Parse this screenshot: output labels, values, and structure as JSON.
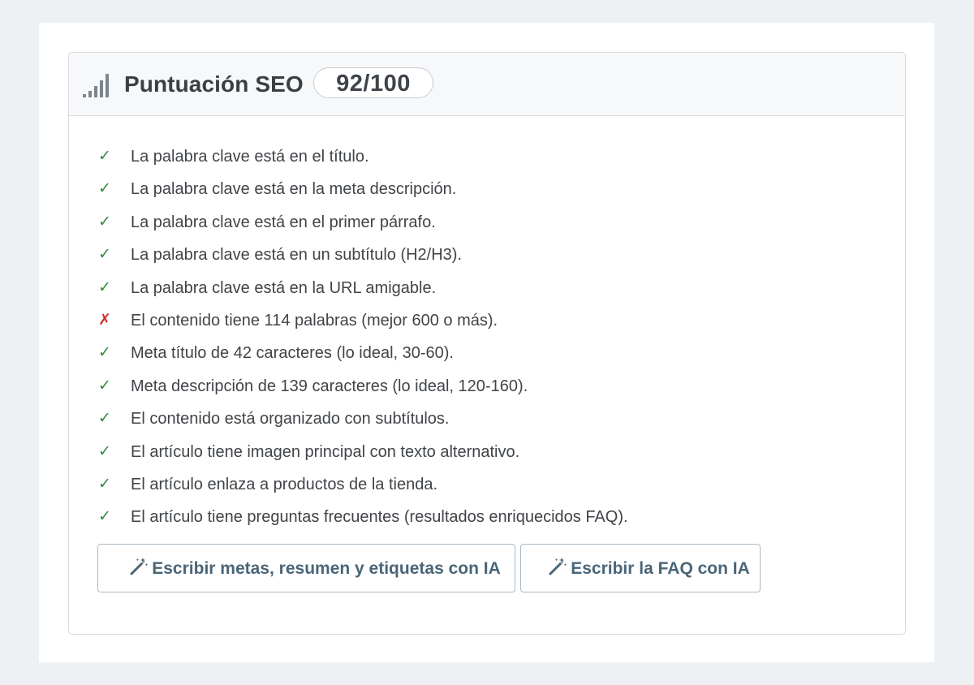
{
  "panel": {
    "title": "Puntuación SEO",
    "score": "92/100",
    "header_icon": "signal-bars-icon"
  },
  "checks": [
    {
      "status": "pass",
      "symbol": "✓",
      "text": "La palabra clave está en el título."
    },
    {
      "status": "pass",
      "symbol": "✓",
      "text": "La palabra clave está en la meta descripción."
    },
    {
      "status": "pass",
      "symbol": "✓",
      "text": "La palabra clave está en el primer párrafo."
    },
    {
      "status": "pass",
      "symbol": "✓",
      "text": "La palabra clave está en un subtítulo (H2/H3)."
    },
    {
      "status": "pass",
      "symbol": "✓",
      "text": "La palabra clave está en la URL amigable."
    },
    {
      "status": "fail",
      "symbol": "✗",
      "text": "El contenido tiene 114 palabras (mejor 600 o más)."
    },
    {
      "status": "pass",
      "symbol": "✓",
      "text": "Meta título de 42 caracteres (lo ideal, 30-60)."
    },
    {
      "status": "pass",
      "symbol": "✓",
      "text": "Meta descripción de 139 caracteres (lo ideal, 120-160)."
    },
    {
      "status": "pass",
      "symbol": "✓",
      "text": "El contenido está organizado con subtítulos."
    },
    {
      "status": "pass",
      "symbol": "✓",
      "text": "El artículo tiene imagen principal con texto alternativo."
    },
    {
      "status": "pass",
      "symbol": "✓",
      "text": "El artículo enlaza a productos de la tienda."
    },
    {
      "status": "pass",
      "symbol": "✓",
      "text": "El artículo tiene preguntas frecuentes (resultados enriquecidos FAQ)."
    }
  ],
  "actions": {
    "metas_label": "Escribir metas, resumen y etiquetas con IA",
    "faq_label": "Escribir la FAQ con IA",
    "icon": "magic-wand-icon"
  },
  "colors": {
    "pass": "#2f8a3a",
    "fail": "#d32f2f",
    "button_text": "#4a6577",
    "button_border": "#aab8c4",
    "header_bg": "#f6f8fa",
    "page_bg": "#eef1f4"
  }
}
